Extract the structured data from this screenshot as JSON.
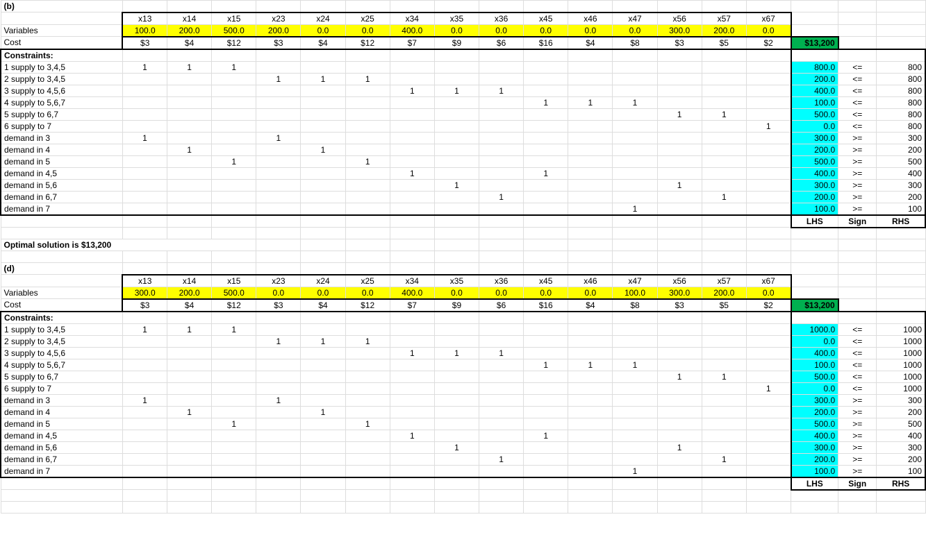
{
  "varCount": 15,
  "varHeaders": [
    "x13",
    "x14",
    "x15",
    "x23",
    "x24",
    "x25",
    "x34",
    "x35",
    "x36",
    "x45",
    "x46",
    "x47",
    "x56",
    "x57",
    "x67"
  ],
  "parts": [
    {
      "label": "(b)",
      "variables": [
        "100.0",
        "200.0",
        "500.0",
        "200.0",
        "0.0",
        "0.0",
        "400.0",
        "0.0",
        "0.0",
        "0.0",
        "0.0",
        "0.0",
        "300.0",
        "200.0",
        "0.0"
      ],
      "costRowLabel": "Cost",
      "costs": [
        "$3",
        "$4",
        "$12",
        "$3",
        "$4",
        "$12",
        "$7",
        "$9",
        "$6",
        "$16",
        "$4",
        "$8",
        "$3",
        "$5",
        "$2"
      ],
      "total": "$13,200",
      "optimal": "Optimal solution is $13,200",
      "constraintsLabel": "Constraints:",
      "variablesLabel": "Variables",
      "footer": {
        "lhs": "LHS",
        "sign": "Sign",
        "rhs": "RHS"
      },
      "constraints": [
        {
          "label": "1 supply to 3,4,5",
          "coeffs": {
            "0": "1",
            "1": "1",
            "2": "1"
          },
          "lhs": "800.0",
          "sign": "<=",
          "rhs": "800"
        },
        {
          "label": "2 supply to 3,4,5",
          "coeffs": {
            "3": "1",
            "4": "1",
            "5": "1"
          },
          "lhs": "200.0",
          "sign": "<=",
          "rhs": "800"
        },
        {
          "label": "3 supply to 4,5,6",
          "coeffs": {
            "6": "1",
            "7": "1",
            "8": "1"
          },
          "lhs": "400.0",
          "sign": "<=",
          "rhs": "800"
        },
        {
          "label": "4 supply to 5,6,7",
          "coeffs": {
            "9": "1",
            "10": "1",
            "11": "1"
          },
          "lhs": "100.0",
          "sign": "<=",
          "rhs": "800"
        },
        {
          "label": "5 supply to 6,7",
          "coeffs": {
            "12": "1",
            "13": "1"
          },
          "lhs": "500.0",
          "sign": "<=",
          "rhs": "800"
        },
        {
          "label": "6 supply to 7",
          "coeffs": {
            "14": "1"
          },
          "lhs": "0.0",
          "sign": "<=",
          "rhs": "800"
        },
        {
          "label": "demand in 3",
          "coeffs": {
            "0": "1",
            "3": "1"
          },
          "lhs": "300.0",
          "sign": ">=",
          "rhs": "300"
        },
        {
          "label": "demand in 4",
          "coeffs": {
            "1": "1",
            "4": "1"
          },
          "lhs": "200.0",
          "sign": ">=",
          "rhs": "200"
        },
        {
          "label": "demand in 5",
          "coeffs": {
            "2": "1",
            "5": "1"
          },
          "lhs": "500.0",
          "sign": ">=",
          "rhs": "500"
        },
        {
          "label": "demand in 4,5",
          "coeffs": {
            "6": "1",
            "9": "1"
          },
          "lhs": "400.0",
          "sign": ">=",
          "rhs": "400"
        },
        {
          "label": "demand in 5,6",
          "coeffs": {
            "7": "1",
            "12": "1"
          },
          "lhs": "300.0",
          "sign": ">=",
          "rhs": "300"
        },
        {
          "label": "demand in 6,7",
          "coeffs": {
            "8": "1",
            "13": "1"
          },
          "lhs": "200.0",
          "sign": ">=",
          "rhs": "200"
        },
        {
          "label": "demand in 7",
          "coeffs": {
            "11": "1"
          },
          "lhs": "100.0",
          "sign": ">=",
          "rhs": "100"
        }
      ]
    },
    {
      "label": "(d)",
      "variables": [
        "300.0",
        "200.0",
        "500.0",
        "0.0",
        "0.0",
        "0.0",
        "400.0",
        "0.0",
        "0.0",
        "0.0",
        "0.0",
        "100.0",
        "300.0",
        "200.0",
        "0.0"
      ],
      "costRowLabel": "Cost",
      "costs": [
        "$3",
        "$4",
        "$12",
        "$3",
        "$4",
        "$12",
        "$7",
        "$9",
        "$6",
        "$16",
        "$4",
        "$8",
        "$3",
        "$5",
        "$2"
      ],
      "total": "$13,200",
      "constraintsLabel": "Constraints:",
      "variablesLabel": "Variables",
      "footer": {
        "lhs": "LHS",
        "sign": "Sign",
        "rhs": "RHS"
      },
      "constraints": [
        {
          "label": "1 supply to 3,4,5",
          "coeffs": {
            "0": "1",
            "1": "1",
            "2": "1"
          },
          "lhs": "1000.0",
          "sign": "<=",
          "rhs": "1000"
        },
        {
          "label": "2 supply to 3,4,5",
          "coeffs": {
            "3": "1",
            "4": "1",
            "5": "1"
          },
          "lhs": "0.0",
          "sign": "<=",
          "rhs": "1000"
        },
        {
          "label": "3 supply to 4,5,6",
          "coeffs": {
            "6": "1",
            "7": "1",
            "8": "1"
          },
          "lhs": "400.0",
          "sign": "<=",
          "rhs": "1000"
        },
        {
          "label": "4 supply to 5,6,7",
          "coeffs": {
            "9": "1",
            "10": "1",
            "11": "1"
          },
          "lhs": "100.0",
          "sign": "<=",
          "rhs": "1000"
        },
        {
          "label": "5 supply to 6,7",
          "coeffs": {
            "12": "1",
            "13": "1"
          },
          "lhs": "500.0",
          "sign": "<=",
          "rhs": "1000"
        },
        {
          "label": "6 supply to 7",
          "coeffs": {
            "14": "1"
          },
          "lhs": "0.0",
          "sign": "<=",
          "rhs": "1000"
        },
        {
          "label": "demand in 3",
          "coeffs": {
            "0": "1",
            "3": "1"
          },
          "lhs": "300.0",
          "sign": ">=",
          "rhs": "300"
        },
        {
          "label": "demand in 4",
          "coeffs": {
            "1": "1",
            "4": "1"
          },
          "lhs": "200.0",
          "sign": ">=",
          "rhs": "200"
        },
        {
          "label": "demand in 5",
          "coeffs": {
            "2": "1",
            "5": "1"
          },
          "lhs": "500.0",
          "sign": ">=",
          "rhs": "500"
        },
        {
          "label": "demand in 4,5",
          "coeffs": {
            "6": "1",
            "9": "1"
          },
          "lhs": "400.0",
          "sign": ">=",
          "rhs": "400"
        },
        {
          "label": "demand in 5,6",
          "coeffs": {
            "7": "1",
            "12": "1"
          },
          "lhs": "300.0",
          "sign": ">=",
          "rhs": "300"
        },
        {
          "label": "demand in 6,7",
          "coeffs": {
            "8": "1",
            "13": "1"
          },
          "lhs": "200.0",
          "sign": ">=",
          "rhs": "200"
        },
        {
          "label": "demand in 7",
          "coeffs": {
            "11": "1"
          },
          "lhs": "100.0",
          "sign": ">=",
          "rhs": "100"
        }
      ]
    }
  ]
}
